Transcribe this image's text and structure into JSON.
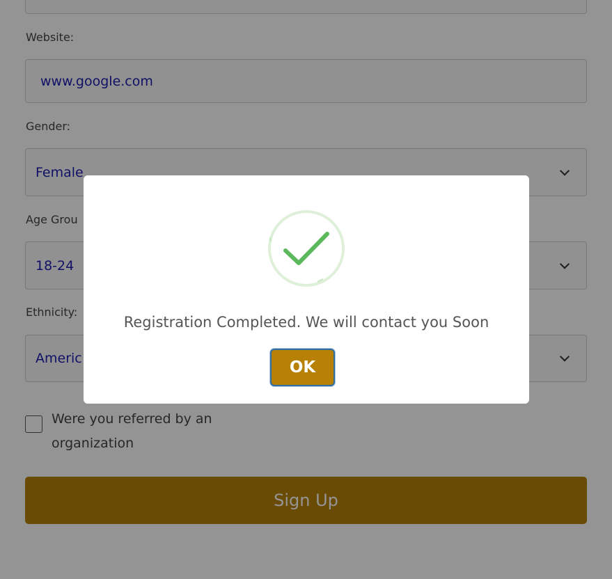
{
  "form": {
    "website": {
      "label": "Website:",
      "value": "www.google.com"
    },
    "gender": {
      "label": "Gender:",
      "value": "Female"
    },
    "age_group": {
      "label": "Age Grou",
      "value": "18-24"
    },
    "ethnicity": {
      "label": "Ethnicity:",
      "value": "Americ"
    },
    "referred": {
      "label": "Were you referred by an organization",
      "checked": false
    },
    "signup_label": "Sign Up"
  },
  "modal": {
    "icon": "success-check-icon",
    "message": "Registration Completed. We will contact you Soon",
    "ok_label": "OK"
  },
  "colors": {
    "accent": "#b78106",
    "value_text": "#1d1db0",
    "success": "#5cb85c"
  }
}
